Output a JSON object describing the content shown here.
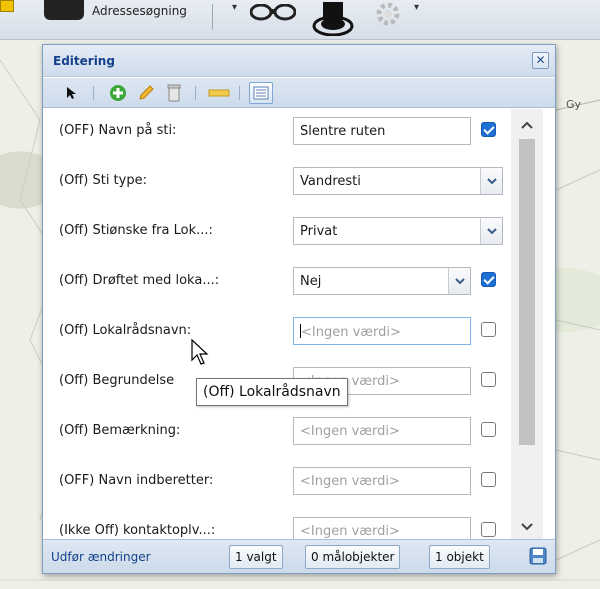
{
  "toolbar": {
    "address_search_label": "Adressesøgning",
    "caret": "▾"
  },
  "map": {
    "label": "Gy"
  },
  "dialog": {
    "title": "Editering",
    "close_glyph": "✕",
    "tools": [
      {
        "name": "select-arrow-icon"
      },
      {
        "name": "add-icon"
      },
      {
        "name": "edit-pencil-icon"
      },
      {
        "name": "delete-bin-icon"
      },
      {
        "name": "measure-ruler-icon"
      },
      {
        "name": "attribute-table-icon"
      }
    ],
    "rows": [
      {
        "label": "(OFF) Navn på sti:",
        "value": "Slentre ruten",
        "kind": "text",
        "checked": true
      },
      {
        "label": "(Off) Sti type:",
        "value": "Vandresti",
        "kind": "select"
      },
      {
        "label": "(Off) Stiønske fra Lok...:",
        "value": "Privat",
        "kind": "select"
      },
      {
        "label": "(Off) Drøftet med loka...:",
        "value": "Nej",
        "kind": "select-short",
        "checked": true
      },
      {
        "label": "(Off) Lokalrådsnavn:",
        "placeholder": "<Ingen værdi>",
        "kind": "text",
        "checked": false,
        "focused": true
      },
      {
        "label": "(Off) Begrundelse",
        "placeholder": "<Ingen værdi>",
        "kind": "text",
        "checked": false
      },
      {
        "label": "(Off) Bemærkning:",
        "placeholder": "<Ingen værdi>",
        "kind": "text",
        "checked": false
      },
      {
        "label": "(OFF) Navn indberetter:",
        "placeholder": "<Ingen værdi>",
        "kind": "text",
        "checked": false
      },
      {
        "label": "(Ikke Off) kontaktoplv...:",
        "placeholder": "<Ingen værdi>",
        "kind": "text",
        "checked": false
      }
    ],
    "tooltip": "(Off) Lokalrådsnavn",
    "footer": {
      "label": "Udfør ændringer",
      "selected_button": "1 valgt",
      "target_button": "0 målobjekter",
      "object_button": "1 objekt"
    }
  },
  "colors": {
    "title_blue": "#15428b",
    "checkbox_blue": "#1e6fd4"
  }
}
